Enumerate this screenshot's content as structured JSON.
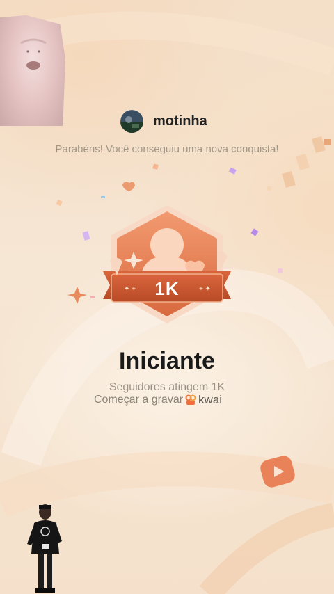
{
  "user": {
    "name": "motinha"
  },
  "message": "Parabéns! Você conseguiu uma nova conquista!",
  "badge": {
    "label": "1K",
    "icon": "follower-badge-icon"
  },
  "achievement": {
    "title": "Iniciante",
    "subtitle": "Seguidores atingem 1K"
  },
  "cta": {
    "label": "Começar a gravar",
    "brand": "kwai"
  },
  "colors": {
    "accent": "#e0774a",
    "badge_dark": "#c65a33",
    "background": "#f5e1cb"
  }
}
